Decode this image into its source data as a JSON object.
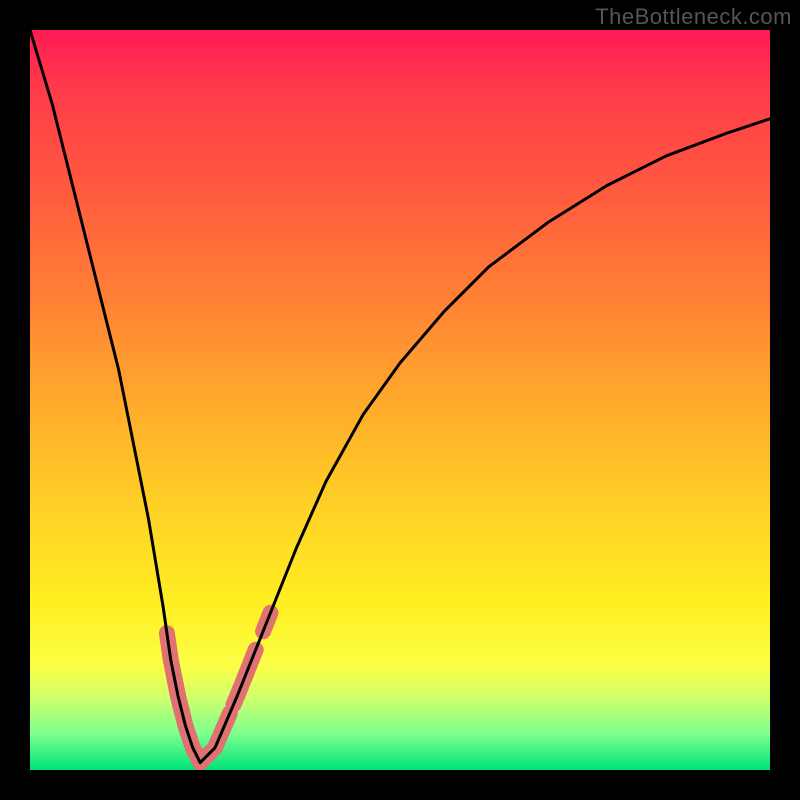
{
  "watermark": "TheBottleneck.com",
  "chart_data": {
    "type": "line",
    "title": "",
    "xlabel": "",
    "ylabel": "",
    "xlim": [
      0,
      100
    ],
    "ylim": [
      0,
      100
    ],
    "series": [
      {
        "name": "left-branch",
        "x": [
          0,
          3,
          6,
          9,
          12,
          14,
          16,
          18,
          19,
          20,
          21,
          22,
          23
        ],
        "values": [
          100,
          90,
          78,
          66,
          54,
          44,
          34,
          22,
          15,
          10,
          6,
          3,
          1
        ]
      },
      {
        "name": "right-branch",
        "x": [
          23,
          25,
          28,
          32,
          36,
          40,
          45,
          50,
          56,
          62,
          70,
          78,
          86,
          94,
          100
        ],
        "values": [
          1,
          3,
          10,
          20,
          30,
          39,
          48,
          55,
          62,
          68,
          74,
          79,
          83,
          86,
          88
        ]
      }
    ],
    "highlight_segments": [
      {
        "branch": "left-branch",
        "x": [
          18.5,
          22.0
        ]
      },
      {
        "branch": "left-branch",
        "x": [
          22.0,
          23.0
        ]
      },
      {
        "branch": "left-branch",
        "x": [
          19.5,
          20.5
        ]
      },
      {
        "branch": "right-branch",
        "x": [
          23.0,
          24.5
        ]
      },
      {
        "branch": "right-branch",
        "x": [
          25.0,
          27.0
        ]
      },
      {
        "branch": "right-branch",
        "x": [
          27.5,
          30.5
        ]
      },
      {
        "branch": "right-branch",
        "x": [
          31.5,
          32.5
        ]
      }
    ]
  },
  "colors": {
    "curve": "#000000",
    "highlight": "#e07272"
  }
}
